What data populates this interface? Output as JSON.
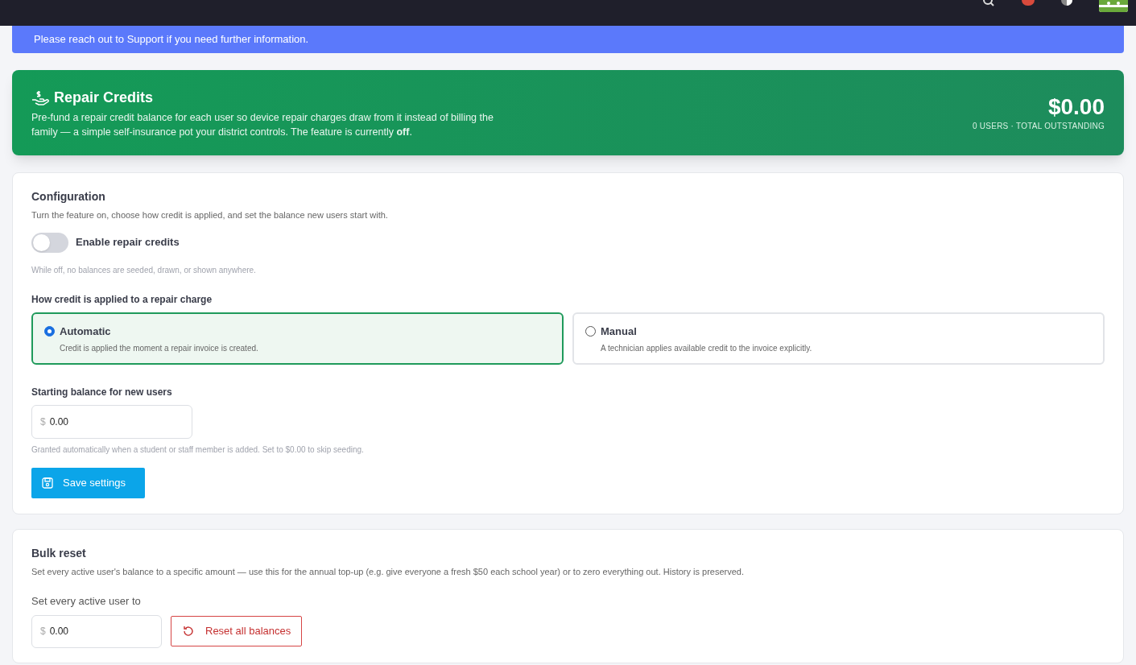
{
  "notice": {
    "text": "Please reach out to Support if you need further information."
  },
  "hero": {
    "title": "Repair Credits",
    "description": "Pre-fund a repair credit balance for each user so device repair charges draw from it instead of billing the family — a simple self-insurance pot your district controls. The feature is currently **off**.",
    "amount": "$0.00",
    "caption": "0 USERS · TOTAL OUTSTANDING"
  },
  "configuration": {
    "title": "Configuration",
    "subtitle": "Turn the feature on, choose how credit is applied, and set the balance new users start with.",
    "toggle": {
      "label": "Enable repair credits",
      "on": false,
      "help": "While off, no balances are seeded, drawn, or shown anywhere."
    },
    "mode_label": "How credit is applied to a repair charge",
    "modes": [
      {
        "title": "Automatic",
        "description": "Credit is applied the moment a repair invoice is created.",
        "selected": true
      },
      {
        "title": "Manual",
        "description": "A technician applies available credit to the invoice explicitly.",
        "selected": false
      }
    ],
    "starting_balance": {
      "label": "Starting balance for new users",
      "prefix": "$",
      "value": "0.00",
      "help": "Granted automatically when a student or staff member is added. Set to $0.00 to skip seeding."
    },
    "save_button": "Save settings"
  },
  "bulk_reset": {
    "title": "Bulk reset",
    "description": "Set every active user's balance to a specific amount — use this for the annual top-up (e.g. give everyone a fresh $50 each school year) or to zero everything out. History is preserved.",
    "field_label": "Set every active user to",
    "prefix": "$",
    "value": "0.00",
    "button": "Reset all balances"
  }
}
